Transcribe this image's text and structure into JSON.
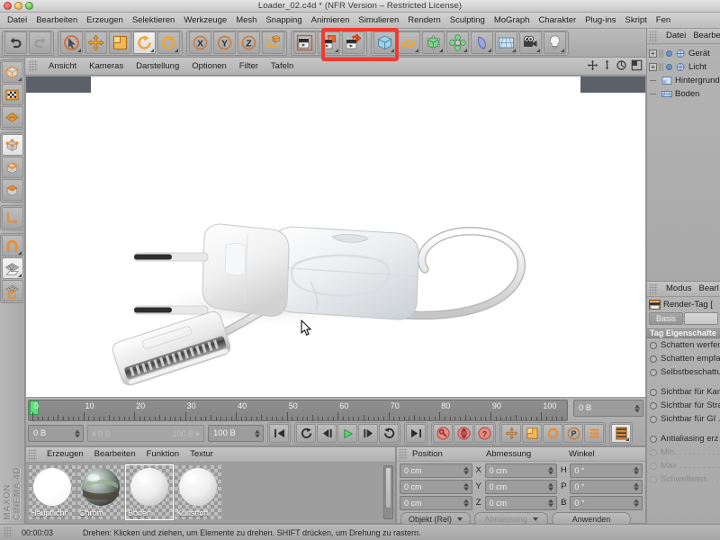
{
  "window": {
    "title": "Loader_02.c4d * (NFR Version – Restricted License)",
    "traffic": [
      "close-button",
      "minimize-button",
      "zoom-button"
    ]
  },
  "menubar": {
    "items": [
      "Datei",
      "Bearbeiten",
      "Erzeugen",
      "Selektieren",
      "Werkzeuge",
      "Mesh",
      "Snapping",
      "Animieren",
      "Simulieren",
      "Rendern",
      "Sculpting",
      "MoGraph",
      "Charakter",
      "Plug-ins",
      "Skript",
      "Fen"
    ]
  },
  "toolbar": {
    "undo_label": "Rückgängig",
    "redo_label": "Wiederherstellen",
    "groups": [
      {
        "name": "history",
        "buttons": [
          "undo-icon",
          "redo-icon"
        ]
      },
      {
        "name": "transform",
        "buttons": [
          "select-cursor-icon",
          "move-icon",
          "scale-icon",
          "rotate-icon",
          "rotate-alt-icon"
        ]
      },
      {
        "name": "axis-locks",
        "buttons": [
          "x-axis-icon",
          "y-axis-icon",
          "z-axis-icon",
          "world-coord-icon"
        ]
      },
      {
        "name": "render",
        "buttons": [
          "render-view-icon",
          "render-region-icon",
          "render-settings-icon"
        ]
      },
      {
        "name": "primitives",
        "buttons": [
          "cube-icon",
          "spline-icon",
          "hypernurbs-icon",
          "array-icon",
          "bend-icon",
          "floor-icon",
          "camera-icon",
          "light-icon"
        ]
      }
    ],
    "highlight": {
      "name": "render-buttons-highlight",
      "color": "#ef3b31"
    }
  },
  "viewport": {
    "menu": [
      "Ansicht",
      "Kameras",
      "Darstellung",
      "Optionen",
      "Filter",
      "Tafeln"
    ],
    "nav_icons": [
      "pan-icon",
      "dolly-icon",
      "rotate-view-icon",
      "layout-icon"
    ],
    "scene_description": "White power adapter with coiled cable and 30-pin dock connector",
    "background_color": "#ffffff"
  },
  "left_tools": {
    "items": [
      "make-editable-icon",
      "texture-axis-icon",
      "polygon-grid-icon",
      "points-mode-icon",
      "edges-mode-icon",
      "polygons-mode-icon",
      "axis-mode-icon",
      "magnet-icon",
      "workplane-icon",
      "workplane-rotate-icon"
    ]
  },
  "brand": {
    "line1": "MAXON",
    "line2": "CINEMA 4D"
  },
  "timeline": {
    "ticks": [
      0,
      10,
      20,
      30,
      40,
      50,
      60,
      70,
      80,
      90,
      100
    ],
    "current_frame": "0 B",
    "range_start": "0 B",
    "range_end": "100 B",
    "end_frame": "100 B",
    "preview_frame": "0 B",
    "playhead_frame": 0,
    "transport": {
      "go_start": "go-to-start-icon",
      "go_end": "go-to-end-icon",
      "prev_key": "previous-keyframe-icon",
      "step_back": "step-back-icon",
      "play": "play-icon",
      "step_forward": "step-forward-icon",
      "loop": "loop-icon"
    },
    "key_buttons": [
      "record-key-icon",
      "autokey-icon",
      "key-selection-icon"
    ],
    "key_filters": [
      "position-key-icon",
      "scale-key-icon",
      "rotation-key-icon",
      "param-key-icon",
      "pla-key-icon"
    ],
    "play_color": "#4fdc6e"
  },
  "material_manager": {
    "menu": [
      "Erzeugen",
      "Bearbeiten",
      "Funktion",
      "Textur"
    ],
    "materials": [
      {
        "name": "Hauptlicht",
        "type": "luminant-white",
        "selected": false
      },
      {
        "name": "Chrom",
        "type": "chrome-reflective",
        "selected": false
      },
      {
        "name": "Boden",
        "type": "white-diffuse",
        "selected": true
      },
      {
        "name": "Kunsttoff",
        "type": "white-plastic",
        "selected": false
      }
    ]
  },
  "coordinates": {
    "columns": [
      "Position",
      "Abmessung",
      "Winkel"
    ],
    "rows": [
      {
        "axis": "X",
        "position": "0 cm",
        "size": "0 cm",
        "angle_label": "H",
        "angle": "0 °"
      },
      {
        "axis": "Y",
        "position": "0 cm",
        "size": "0 cm",
        "angle_label": "P",
        "angle": "0 °"
      },
      {
        "axis": "Z",
        "position": "0 cm",
        "size": "0 cm",
        "angle_label": "B",
        "angle": "0 °"
      }
    ],
    "mode_dropdown": "Objekt (Rel)",
    "size_dropdown": "Abmessung",
    "apply_button": "Anwenden"
  },
  "object_manager": {
    "menu": [
      "Datei",
      "Bearbe"
    ],
    "objects": [
      {
        "label": "Gerät",
        "expandable": true,
        "icon": "null-object-icon"
      },
      {
        "label": "Licht",
        "expandable": true,
        "icon": "null-object-icon"
      },
      {
        "label": "Hintergrund",
        "expandable": false,
        "icon": "background-object-icon"
      },
      {
        "label": "Boden",
        "expandable": false,
        "icon": "floor-object-icon"
      }
    ]
  },
  "attribute_manager": {
    "menu": [
      "Modus",
      "Bearl"
    ],
    "tag_title": "Render-Tag [",
    "tag_icon": "render-tag-icon",
    "tabs": [
      {
        "label": "Basis",
        "active": true
      },
      {
        "label": "",
        "active": false
      }
    ],
    "section": "Tag Eigenschafte",
    "properties": [
      {
        "label": "Schatten werfen",
        "enabled": true
      },
      {
        "label": "Schatten empfa",
        "enabled": true
      },
      {
        "label": "Selbstbeschattu",
        "enabled": true
      },
      {
        "label": "",
        "enabled": true,
        "spacer": true
      },
      {
        "label": "Sichtbar für Kan",
        "enabled": true
      },
      {
        "label": "Sichtbar für Stra",
        "enabled": true
      },
      {
        "label": "Sichtbar für GI .",
        "enabled": true
      },
      {
        "label": "",
        "enabled": true,
        "spacer": true
      },
      {
        "label": "Antialiasing erz",
        "enabled": true
      },
      {
        "label": "Min. . . . . . . . . . . .",
        "enabled": false
      },
      {
        "label": "Max . . . . . . . . . .",
        "enabled": false
      },
      {
        "label": "Schwellwert. . . .",
        "enabled": false
      }
    ]
  },
  "statusbar": {
    "time": "00:00:03",
    "message": "Drehen: Klicken und ziehen, um Elemente zu drehen. SHIFT drücken, um Drehung zu rastern."
  }
}
